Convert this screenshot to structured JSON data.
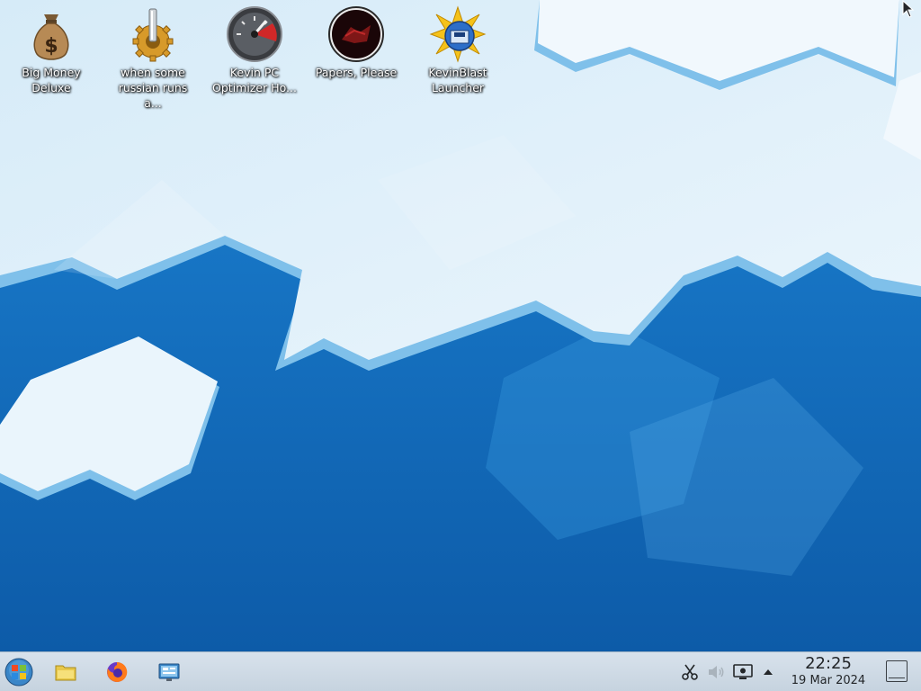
{
  "desktop": {
    "icons": [
      {
        "label_line1": "Big Money",
        "label_line2": "Deluxe",
        "icon": "money-bag-icon"
      },
      {
        "label_line1": "when some",
        "label_line2": "russian runs a...",
        "icon": "gear-icon"
      },
      {
        "label_line1": "Kevin PC",
        "label_line2": "Optimizer Ho...",
        "icon": "speedometer-icon"
      },
      {
        "label_line1": "Papers, Please",
        "label_line2": "",
        "icon": "papers-please-icon"
      },
      {
        "label_line1": "KevinBlast",
        "label_line2": "Launcher",
        "icon": "kevinblast-icon"
      }
    ]
  },
  "taskbar": {
    "launchers": [
      {
        "icon": "start-menu-icon"
      },
      {
        "icon": "file-manager-icon"
      },
      {
        "icon": "firefox-icon"
      },
      {
        "icon": "system-settings-icon"
      }
    ],
    "tray": [
      {
        "icon": "scissors-icon"
      },
      {
        "icon": "volume-icon"
      },
      {
        "icon": "display-icon"
      },
      {
        "icon": "tray-expand-arrow-icon"
      }
    ],
    "clock": {
      "time": "22:25",
      "date": "19 Mar 2024"
    }
  },
  "colors": {
    "ice": "#e3f1fb",
    "ice_edge": "#8fc9ee",
    "sea": "#1672c4",
    "taskbar": "#cfdae5"
  }
}
